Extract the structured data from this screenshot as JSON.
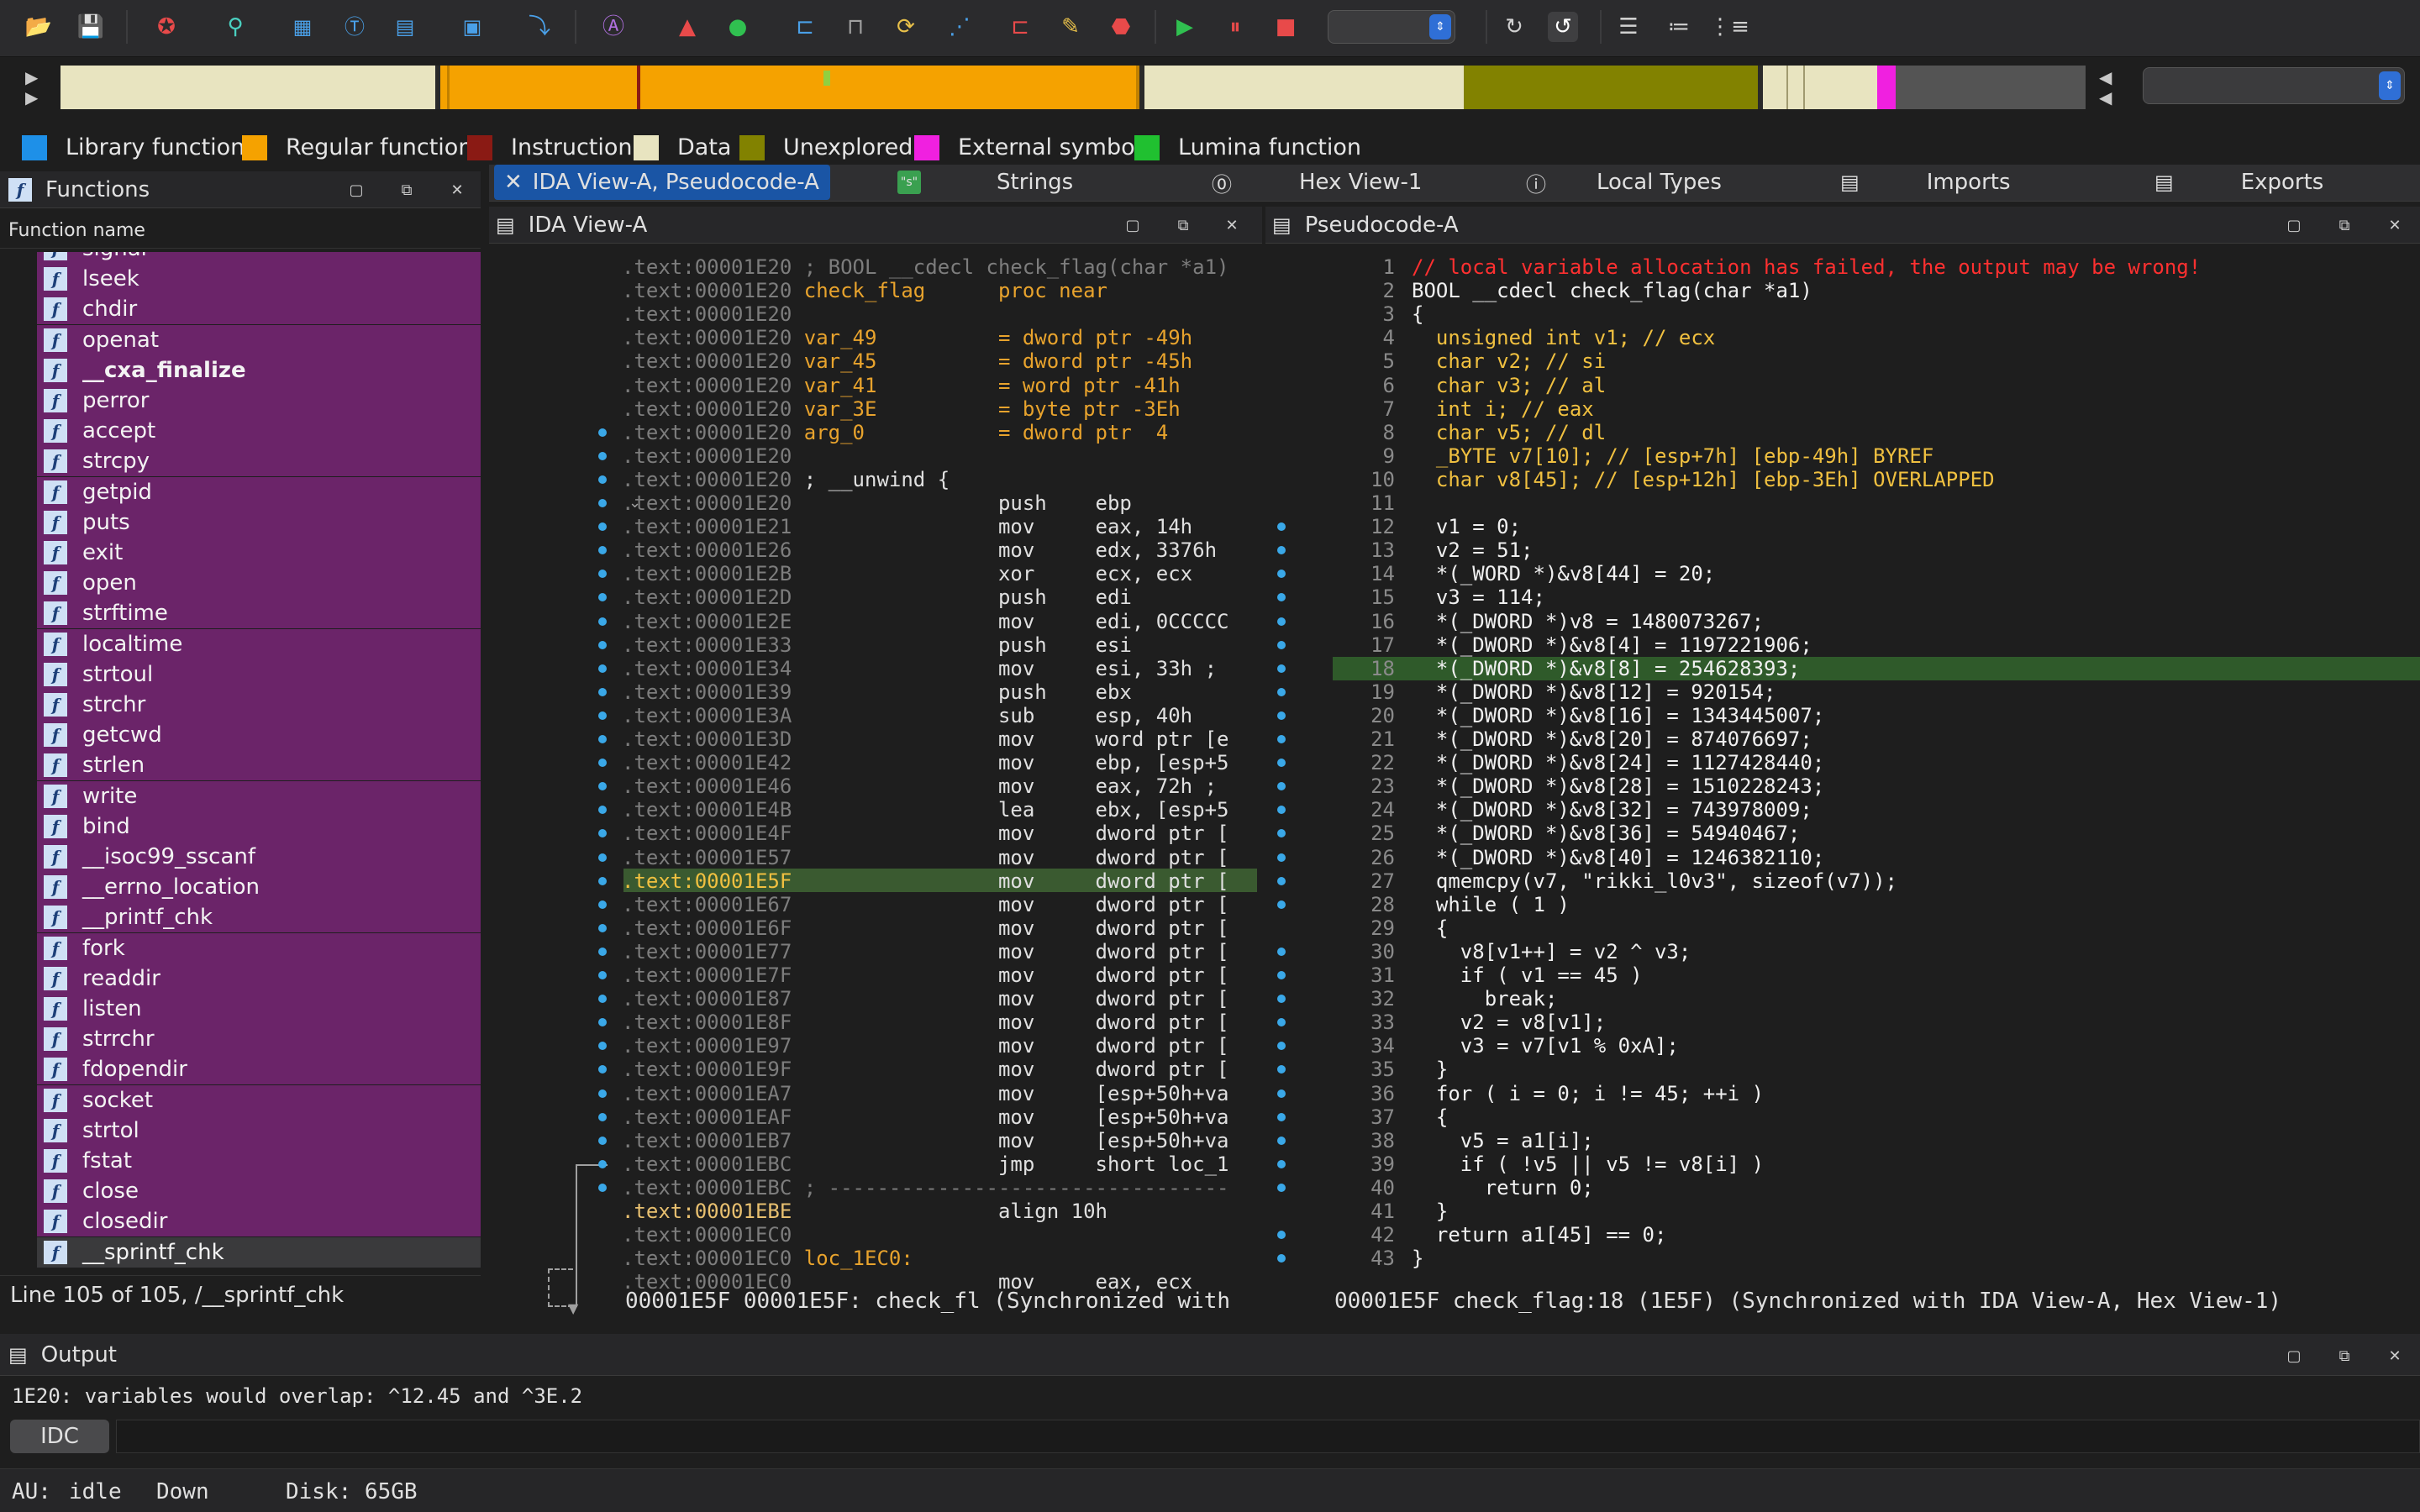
{
  "toolbar": {
    "icons": [
      "open-folder-icon",
      "save-icon",
      "debug-icon",
      "search-icon",
      "binary-icon",
      "text-icon",
      "hex-icon",
      "segments-icon",
      "jump-icon",
      "font-a-icon",
      "color-icon",
      "run-icon",
      "bracket-icon",
      "function-icon",
      "code-icon",
      "xref-icon",
      "struct-icon",
      "pen-icon",
      "stop-sign-icon",
      "play-icon",
      "pause-icon",
      "stop-icon",
      "layout-icon",
      "refresh-icon",
      "list-icon",
      "listing-icon",
      "graph-icon"
    ],
    "combo1": "",
    "combo2": ""
  },
  "legend": {
    "items": [
      {
        "label": "Library function",
        "color": "#1e90e8"
      },
      {
        "label": "Regular function",
        "color": "#f5a200"
      },
      {
        "label": "Instruction",
        "color": "#8a1a14"
      },
      {
        "label": "Data",
        "color": "#e8e4c0"
      },
      {
        "label": "Unexplored",
        "color": "#828200"
      },
      {
        "label": "External symbol",
        "color": "#f020e0"
      },
      {
        "label": "Lumina function",
        "color": "#20c030"
      }
    ]
  },
  "tabs": {
    "main": [
      {
        "label": "IDA View-A, Pseudocode-A",
        "icon": "close-icon",
        "active": true
      },
      {
        "label": "Strings",
        "icon": "strings-icon"
      },
      {
        "label": "Hex View-1",
        "icon": "hex-view-icon"
      },
      {
        "label": "Local Types",
        "icon": "local-types-icon"
      },
      {
        "label": "Imports",
        "icon": "imports-icon"
      },
      {
        "label": "Exports",
        "icon": "exports-icon"
      }
    ]
  },
  "functions": {
    "title": "Functions",
    "column": "Function name",
    "items": [
      "signal",
      "lseek",
      "chdir",
      "openat",
      "__cxa_finalize",
      "perror",
      "accept",
      "strcpy",
      "getpid",
      "puts",
      "exit",
      "open",
      "strftime",
      "localtime",
      "strtoul",
      "strchr",
      "getcwd",
      "strlen",
      "write",
      "bind",
      "__isoc99_sscanf",
      "__errno_location",
      "__printf_chk",
      "fork",
      "readdir",
      "listen",
      "strrchr",
      "fdopendir",
      "socket",
      "strtol",
      "fstat",
      "close",
      "closedir",
      "__sprintf_chk"
    ],
    "status": "Line 105 of 105, /__sprintf_chk"
  },
  "ida_view": {
    "title": "IDA View-A",
    "lines": [
      {
        "a": ".text:00001E20",
        "t": "; BOOL __cdecl check_flag(char *a1)",
        "c": "cmt"
      },
      {
        "a": ".text:00001E20",
        "t": "check_flag      proc near",
        "c": "lbl"
      },
      {
        "a": ".text:00001E20",
        "t": "",
        "c": "kw"
      },
      {
        "a": ".text:00001E20",
        "t": "var_49          = dword ptr -49h",
        "c": "var"
      },
      {
        "a": ".text:00001E20",
        "t": "var_45          = dword ptr -45h",
        "c": "var"
      },
      {
        "a": ".text:00001E20",
        "t": "var_41          = word ptr -41h",
        "c": "var"
      },
      {
        "a": ".text:00001E20",
        "t": "var_3E          = byte ptr -3Eh",
        "c": "var"
      },
      {
        "a": ".text:00001E20",
        "t": "arg_0           = dword ptr  4",
        "c": "var"
      },
      {
        "a": ".text:00001E20",
        "t": "",
        "c": "kw"
      },
      {
        "a": ".text:00001E20",
        "t": "; __unwind {",
        "c": "kw"
      },
      {
        "a": ".text:00001E20",
        "t": "                push    ebp",
        "c": "kw"
      },
      {
        "a": ".text:00001E21",
        "t": "                mov     eax, 14h",
        "c": "kw"
      },
      {
        "a": ".text:00001E26",
        "t": "                mov     edx, 3376h",
        "c": "kw"
      },
      {
        "a": ".text:00001E2B",
        "t": "                xor     ecx, ecx",
        "c": "kw"
      },
      {
        "a": ".text:00001E2D",
        "t": "                push    edi",
        "c": "kw"
      },
      {
        "a": ".text:00001E2E",
        "t": "                mov     edi, 0CCCCC",
        "c": "kw"
      },
      {
        "a": ".text:00001E33",
        "t": "                push    esi",
        "c": "kw"
      },
      {
        "a": ".text:00001E34",
        "t": "                mov     esi, 33h ;",
        "c": "kw"
      },
      {
        "a": ".text:00001E39",
        "t": "                push    ebx",
        "c": "kw"
      },
      {
        "a": ".text:00001E3A",
        "t": "                sub     esp, 40h",
        "c": "kw"
      },
      {
        "a": ".text:00001E3D",
        "t": "                mov     word ptr [e",
        "c": "kw"
      },
      {
        "a": ".text:00001E42",
        "t": "                mov     ebp, [esp+5",
        "c": "kw"
      },
      {
        "a": ".text:00001E46",
        "t": "                mov     eax, 72h ;",
        "c": "kw"
      },
      {
        "a": ".text:00001E4B",
        "t": "                lea     ebx, [esp+5",
        "c": "kw"
      },
      {
        "a": ".text:00001E4F",
        "t": "                mov     dword ptr [",
        "c": "kw"
      },
      {
        "a": ".text:00001E57",
        "t": "                mov     dword ptr [",
        "c": "kw"
      },
      {
        "a": ".text:00001E5F",
        "t": "                mov     dword ptr [",
        "c": "kw",
        "hl": true
      },
      {
        "a": ".text:00001E67",
        "t": "                mov     dword ptr [",
        "c": "kw"
      },
      {
        "a": ".text:00001E6F",
        "t": "                mov     dword ptr [",
        "c": "kw"
      },
      {
        "a": ".text:00001E77",
        "t": "                mov     dword ptr [",
        "c": "kw"
      },
      {
        "a": ".text:00001E7F",
        "t": "                mov     dword ptr [",
        "c": "kw"
      },
      {
        "a": ".text:00001E87",
        "t": "                mov     dword ptr [",
        "c": "kw"
      },
      {
        "a": ".text:00001E8F",
        "t": "                mov     dword ptr [",
        "c": "kw"
      },
      {
        "a": ".text:00001E97",
        "t": "                mov     dword ptr [",
        "c": "kw"
      },
      {
        "a": ".text:00001E9F",
        "t": "                mov     dword ptr [",
        "c": "kw"
      },
      {
        "a": ".text:00001EA7",
        "t": "                mov     [esp+50h+va",
        "c": "kw"
      },
      {
        "a": ".text:00001EAF",
        "t": "                mov     [esp+50h+va",
        "c": "kw"
      },
      {
        "a": ".text:00001EB7",
        "t": "                mov     [esp+50h+va",
        "c": "kw"
      },
      {
        "a": ".text:00001EBC",
        "t": "                jmp     short loc_1",
        "c": "kw"
      },
      {
        "a": ".text:00001EBC",
        "t": "; ---------------------------------",
        "c": "cmt"
      },
      {
        "a": ".text:00001EBE",
        "t": "                align 10h",
        "c": "kw"
      },
      {
        "a": ".text:00001EC0",
        "t": "",
        "c": "kw"
      },
      {
        "a": ".text:00001EC0",
        "t": "loc_1EC0:",
        "c": "lbl"
      },
      {
        "a": ".text:00001EC0",
        "t": "                mov     eax, ecx",
        "c": "kw"
      }
    ],
    "status": "00001E5F 00001E5F: check_fl (Synchronized with"
  },
  "pseudocode": {
    "title": "Pseudocode-A",
    "lines": [
      {
        "n": "1",
        "t": "// local variable allocation has failed, the output may be wrong!"
      },
      {
        "n": "2",
        "t": "BOOL __cdecl check_flag(char *a1)"
      },
      {
        "n": "3",
        "t": "{"
      },
      {
        "n": "4",
        "t": "  unsigned int v1; // ecx"
      },
      {
        "n": "5",
        "t": "  char v2; // si"
      },
      {
        "n": "6",
        "t": "  char v3; // al"
      },
      {
        "n": "7",
        "t": "  int i; // eax"
      },
      {
        "n": "8",
        "t": "  char v5; // dl"
      },
      {
        "n": "9",
        "t": "  _BYTE v7[10]; // [esp+7h] [ebp-49h] BYREF"
      },
      {
        "n": "10",
        "t": "  char v8[45]; // [esp+12h] [ebp-3Eh] OVERLAPPED"
      },
      {
        "n": "11",
        "t": ""
      },
      {
        "n": "12",
        "t": "  v1 = 0;"
      },
      {
        "n": "13",
        "t": "  v2 = 51;"
      },
      {
        "n": "14",
        "t": "  *(_WORD *)&v8[44] = 20;"
      },
      {
        "n": "15",
        "t": "  v3 = 114;"
      },
      {
        "n": "16",
        "t": "  *(_DWORD *)v8 = 1480073267;"
      },
      {
        "n": "17",
        "t": "  *(_DWORD *)&v8[4] = 1197221906;"
      },
      {
        "n": "18",
        "t": "  *(_DWORD *)&v8[8] = 254628393;",
        "hl": true
      },
      {
        "n": "19",
        "t": "  *(_DWORD *)&v8[12] = 920154;"
      },
      {
        "n": "20",
        "t": "  *(_DWORD *)&v8[16] = 1343445007;"
      },
      {
        "n": "21",
        "t": "  *(_DWORD *)&v8[20] = 874076697;"
      },
      {
        "n": "22",
        "t": "  *(_DWORD *)&v8[24] = 1127428440;"
      },
      {
        "n": "23",
        "t": "  *(_DWORD *)&v8[28] = 1510228243;"
      },
      {
        "n": "24",
        "t": "  *(_DWORD *)&v8[32] = 743978009;"
      },
      {
        "n": "25",
        "t": "  *(_DWORD *)&v8[36] = 54940467;"
      },
      {
        "n": "26",
        "t": "  *(_DWORD *)&v8[40] = 1246382110;"
      },
      {
        "n": "27",
        "t": "  qmemcpy(v7, \"rikki_l0v3\", sizeof(v7));"
      },
      {
        "n": "28",
        "t": "  while ( 1 )"
      },
      {
        "n": "29",
        "t": "  {"
      },
      {
        "n": "30",
        "t": "    v8[v1++] = v2 ^ v3;"
      },
      {
        "n": "31",
        "t": "    if ( v1 == 45 )"
      },
      {
        "n": "32",
        "t": "      break;"
      },
      {
        "n": "33",
        "t": "    v2 = v8[v1];"
      },
      {
        "n": "34",
        "t": "    v3 = v7[v1 % 0xA];"
      },
      {
        "n": "35",
        "t": "  }"
      },
      {
        "n": "36",
        "t": "  for ( i = 0; i != 45; ++i )"
      },
      {
        "n": "37",
        "t": "  {"
      },
      {
        "n": "38",
        "t": "    v5 = a1[i];"
      },
      {
        "n": "39",
        "t": "    if ( !v5 || v5 != v8[i] )"
      },
      {
        "n": "40",
        "t": "      return 0;"
      },
      {
        "n": "41",
        "t": "  }"
      },
      {
        "n": "42",
        "t": "  return a1[45] == 0;"
      },
      {
        "n": "43",
        "t": "}"
      }
    ],
    "status": "00001E5F check_flag:18 (1E5F) (Synchronized with IDA View-A, Hex View-1)"
  },
  "output": {
    "title": "Output",
    "text": "1E20: variables would overlap: ^12.45 and ^3E.2",
    "idc_label": "IDC"
  },
  "statusbar": {
    "au": "AU:",
    "state": "idle",
    "direction": "Down",
    "disk": "Disk: 65GB"
  }
}
